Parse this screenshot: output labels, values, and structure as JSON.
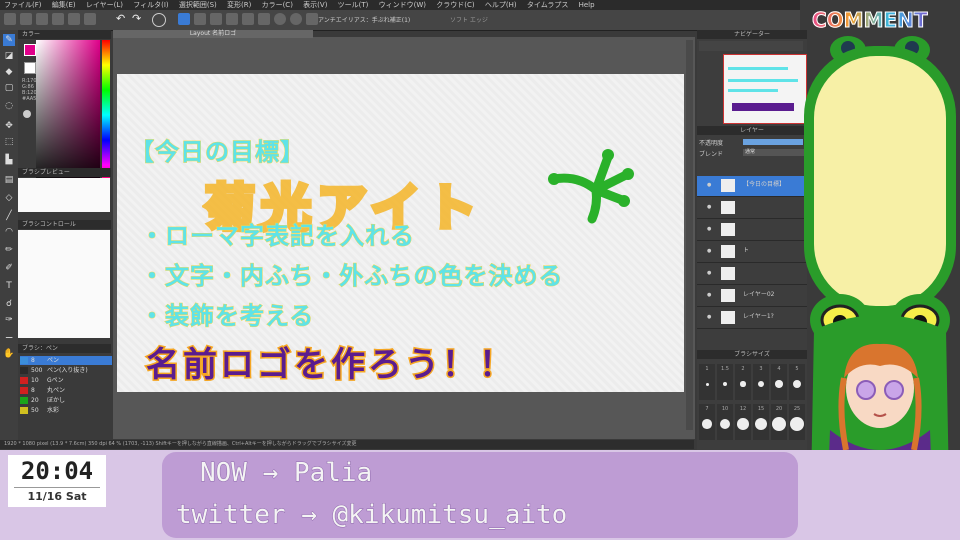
{
  "menu": [
    "ファイル(F)",
    "編集(E)",
    "レイヤー(L)",
    "フィルタ(I)",
    "選択範囲(S)",
    "変形(R)",
    "カラー(C)",
    "表示(V)",
    "ツール(T)",
    "ウィンドウ(W)",
    "クラウド(C)",
    "ヘルプ(H)",
    "タイムラプス",
    "Help"
  ],
  "toolbar": {
    "antialias_label": "アンチエイリアス：手ぶれ補正(1)",
    "correction_label": "ソフト エッジ"
  },
  "document_tab": "Layout 名前ロゴ",
  "panels": {
    "color": "カラー",
    "brush_preview": "ブラシプレビュー",
    "brush_control": "ブラシコントロール",
    "brush": "ブラシ：ペン",
    "navigator": "ナビゲーター",
    "layer": "レイヤー",
    "brush_size": "ブラシサイズ"
  },
  "color_values": {
    "r": "R:170",
    "g": "G:86",
    "b": "B:120",
    "hex": "#AA5678"
  },
  "brushes": [
    {
      "size": "8",
      "name": "ペン",
      "color": "#3b8edb"
    },
    {
      "size": "500",
      "name": "ペン(入り抜き)",
      "color": "#2a2a2a"
    },
    {
      "size": "10",
      "name": "Gペン",
      "color": "#d02020"
    },
    {
      "size": "8",
      "name": "丸ペン",
      "color": "#d02020"
    },
    {
      "size": "20",
      "name": "ぼかし",
      "color": "#1aa51a"
    },
    {
      "size": "50",
      "name": "水彩",
      "color": "#d0c020"
    }
  ],
  "canvas": {
    "heading": "【今日の目標】",
    "logo_text": "菊光アイト",
    "items": [
      "・ローマ字表記を入れる",
      "・文字・内ふち・外ふちの色を決める",
      "・装飾を考える"
    ],
    "title": "名前ロゴを作ろう！！"
  },
  "status_bar": "1920 * 1080 pixel   (13.9 * 7.6cm)   350 dpi   64 %   (1703, -113)   Shiftキーを押しながら直線描画、Ctrl+Altキーを押しながらドラッグでブラシサイズ変更",
  "layer_panel": {
    "opacity_label": "不透明度",
    "blend_label": "ブレンド",
    "blend_value": "通常",
    "rows": [
      "【今日の目標】",
      "",
      "",
      "ト",
      "",
      "レイヤー02",
      "レイヤー1?"
    ]
  },
  "brush_size_values": [
    "1",
    "1.5",
    "2",
    "3",
    "4",
    "5",
    "7",
    "10",
    "12",
    "15",
    "20",
    "25"
  ],
  "comment_label": "COMMENT",
  "clock": {
    "time": "20:04",
    "date": "11/16 Sat"
  },
  "stream_info": {
    "now_line": "NOW  → Palia",
    "twitter_line": "twitter → @kikumitsu_aito"
  }
}
